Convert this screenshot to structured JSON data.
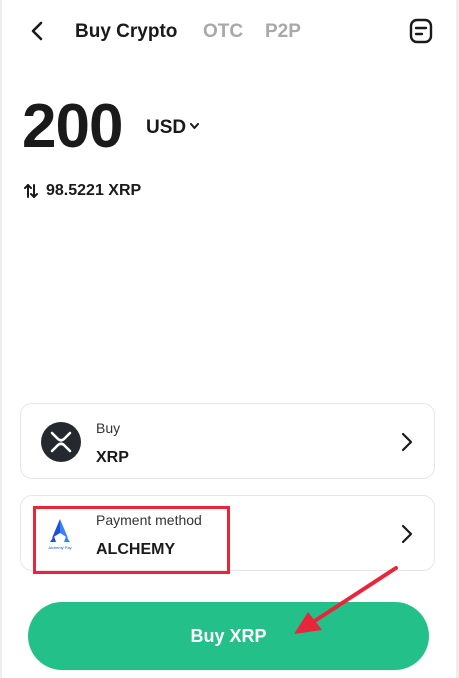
{
  "header": {
    "tabs": [
      {
        "label": "Buy Crypto",
        "active": true
      },
      {
        "label": "OTC",
        "active": false
      },
      {
        "label": "P2P",
        "active": false
      }
    ],
    "back_icon": "back-arrow-icon",
    "orders_icon": "orders-icon"
  },
  "amount": {
    "value": "200",
    "currency": "USD"
  },
  "conversion": {
    "text": "98.5221 XRP"
  },
  "buy_card": {
    "caption": "Buy",
    "value": "XRP",
    "icon": "xrp-logo-icon"
  },
  "payment_card": {
    "caption": "Payment method",
    "value": "ALCHEMY",
    "icon": "alchemy-pay-logo",
    "logo_text": "Alchemy Pay"
  },
  "buy_button": {
    "label": "Buy XRP"
  },
  "colors": {
    "accent": "#23c089",
    "annotation_red": "#e8263b",
    "inactive_tab": "#a9a9a9"
  }
}
